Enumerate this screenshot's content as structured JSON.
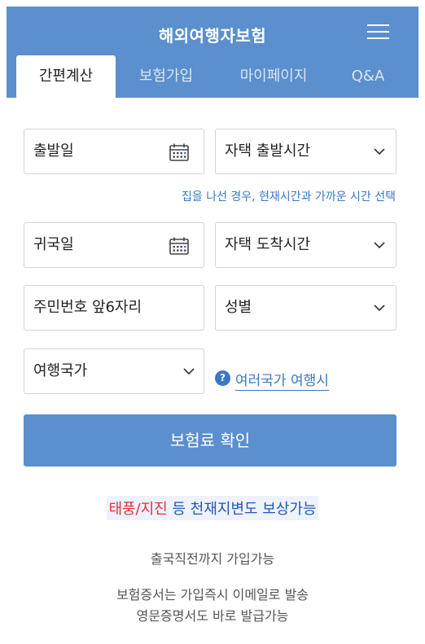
{
  "header": {
    "title": "해외여행자보험",
    "menu_icon": "hamburger-menu-icon",
    "background": "#5b8fcd"
  },
  "tabs": [
    {
      "label": "간편계산",
      "active": true
    },
    {
      "label": "보험가입",
      "active": false
    },
    {
      "label": "마이페이지",
      "active": false
    },
    {
      "label": "Q&A",
      "active": false
    }
  ],
  "form": {
    "departure_date": {
      "label": "출발일",
      "icon": "calendar-icon"
    },
    "departure_time": {
      "label": "자택 출발시간",
      "icon": "chevron-down-icon"
    },
    "departure_hint": "집을 나선 경우, 현재시간과 가까운 시간 선택",
    "return_date": {
      "label": "귀국일",
      "icon": "calendar-icon"
    },
    "arrival_time": {
      "label": "자택 도착시간",
      "icon": "chevron-down-icon"
    },
    "resident_number": {
      "label": "주민번호 앞6자리"
    },
    "gender": {
      "label": "성별",
      "icon": "chevron-down-icon"
    },
    "country": {
      "label": "여행국가",
      "icon": "chevron-down-icon"
    },
    "multi_country": {
      "icon_text": "?",
      "label": "여러국가 여행시"
    }
  },
  "cta": {
    "label": "보험료 확인"
  },
  "promo": {
    "red_text": "태풍/지진",
    "blue_text1": "등",
    "blue_text2": "천재지변도 보상가능",
    "red_color": "#e0323c",
    "blue_color": "#1f57b8"
  },
  "info": {
    "line1": "출국직전까지 가입가능",
    "line2": "보험증서는 가입즉시 이메일로 발송",
    "line3": "영문증명서도 바로 발급가능"
  }
}
